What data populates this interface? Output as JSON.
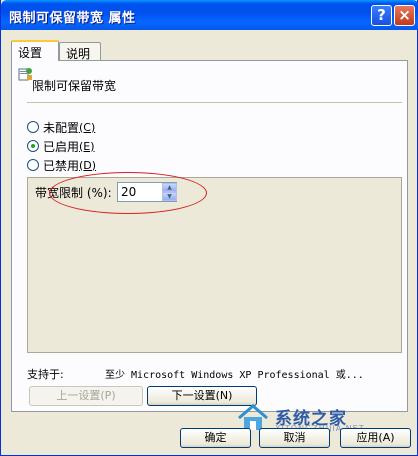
{
  "window": {
    "title": "限制可保留带宽 属性",
    "help_glyph": "?",
    "close_glyph": "×"
  },
  "tabs": [
    {
      "label": "设置",
      "active": true
    },
    {
      "label": "说明",
      "active": false
    }
  ],
  "policy": {
    "name": "限制可保留带宽",
    "icon": "policy-icon"
  },
  "radios": [
    {
      "label": "未配置",
      "accel": "(C)",
      "checked": false
    },
    {
      "label": "已启用",
      "accel": "(E)",
      "checked": true
    },
    {
      "label": "已禁用",
      "accel": "(D)",
      "checked": false
    }
  ],
  "bandwidth": {
    "label": "带宽限制 (%):",
    "value": "20"
  },
  "support": {
    "label": "支持于:",
    "value": "至少 Microsoft Windows XP Professional 或..."
  },
  "nav_buttons": {
    "prev": "上一设置(P)",
    "next": "下一设置(N)",
    "prev_disabled": true
  },
  "dialog_buttons": {
    "ok": "确定",
    "cancel": "取消",
    "apply": "应用(A)"
  },
  "watermark": {
    "text": "系统之家",
    "url": "XITONGZHIJIA.NET"
  },
  "colors": {
    "titlebar": "#0053ee",
    "dialog_bg": "#ece9d8",
    "highlight_ellipse": "#d62020",
    "radio_dot": "#21a121"
  }
}
